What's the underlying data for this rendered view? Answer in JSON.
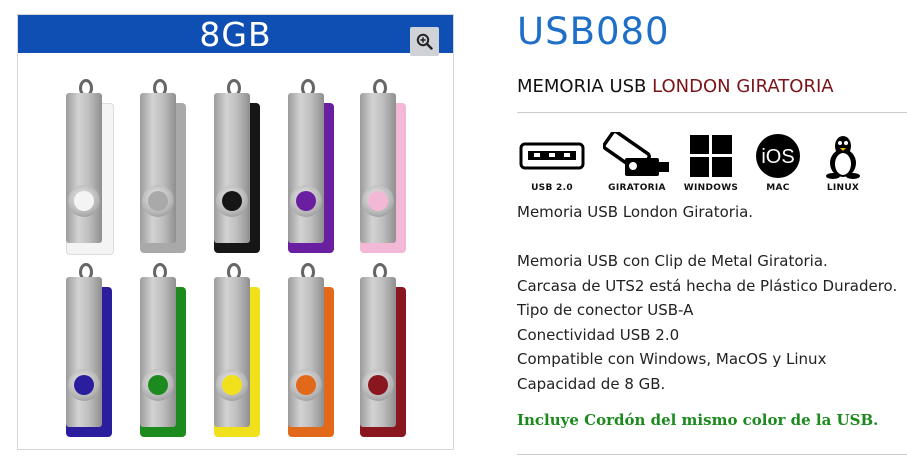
{
  "product_image": {
    "capacity_banner": "8GB",
    "zoom_icon": "zoom-in-icon",
    "usb_colors_row1": [
      "#f4f4f4",
      "#a9a9a9",
      "#161616",
      "#6a1fa0",
      "#f3b8d6"
    ],
    "usb_colors_row2": [
      "#2a1d9e",
      "#1d8a1d",
      "#f1e01c",
      "#e2681a",
      "#8a1620"
    ]
  },
  "product": {
    "code": "USB080",
    "title_prefix": "MEMORIA USB ",
    "title_highlight": "LONDON GIRATORIA",
    "title_color": "#1f6fc6",
    "highlight_color": "#7a1418"
  },
  "features": [
    {
      "icon": "usb-2-icon",
      "label": "USB 2.0"
    },
    {
      "icon": "swivel-icon",
      "label": "GIRATORIA"
    },
    {
      "icon": "windows-icon",
      "label": "WINDOWS"
    },
    {
      "icon": "ios-icon",
      "label": "MAC"
    },
    {
      "icon": "linux-icon",
      "label": "LINUX"
    }
  ],
  "description": {
    "intro": "Memoria USB London Giratoria.",
    "lines": [
      "Memoria USB con Clip de Metal Giratoria.",
      "Carcasa de UTS2 está hecha de Plástico Duradero.",
      "Tipo de conector USB-A",
      "Conectividad USB 2.0",
      "Compatible con Windows, MacOS y Linux",
      "Capacidad de 8 GB."
    ],
    "promo": "Incluye Cordón del mismo color de la USB.",
    "promo_color": "#1c8a1c"
  }
}
